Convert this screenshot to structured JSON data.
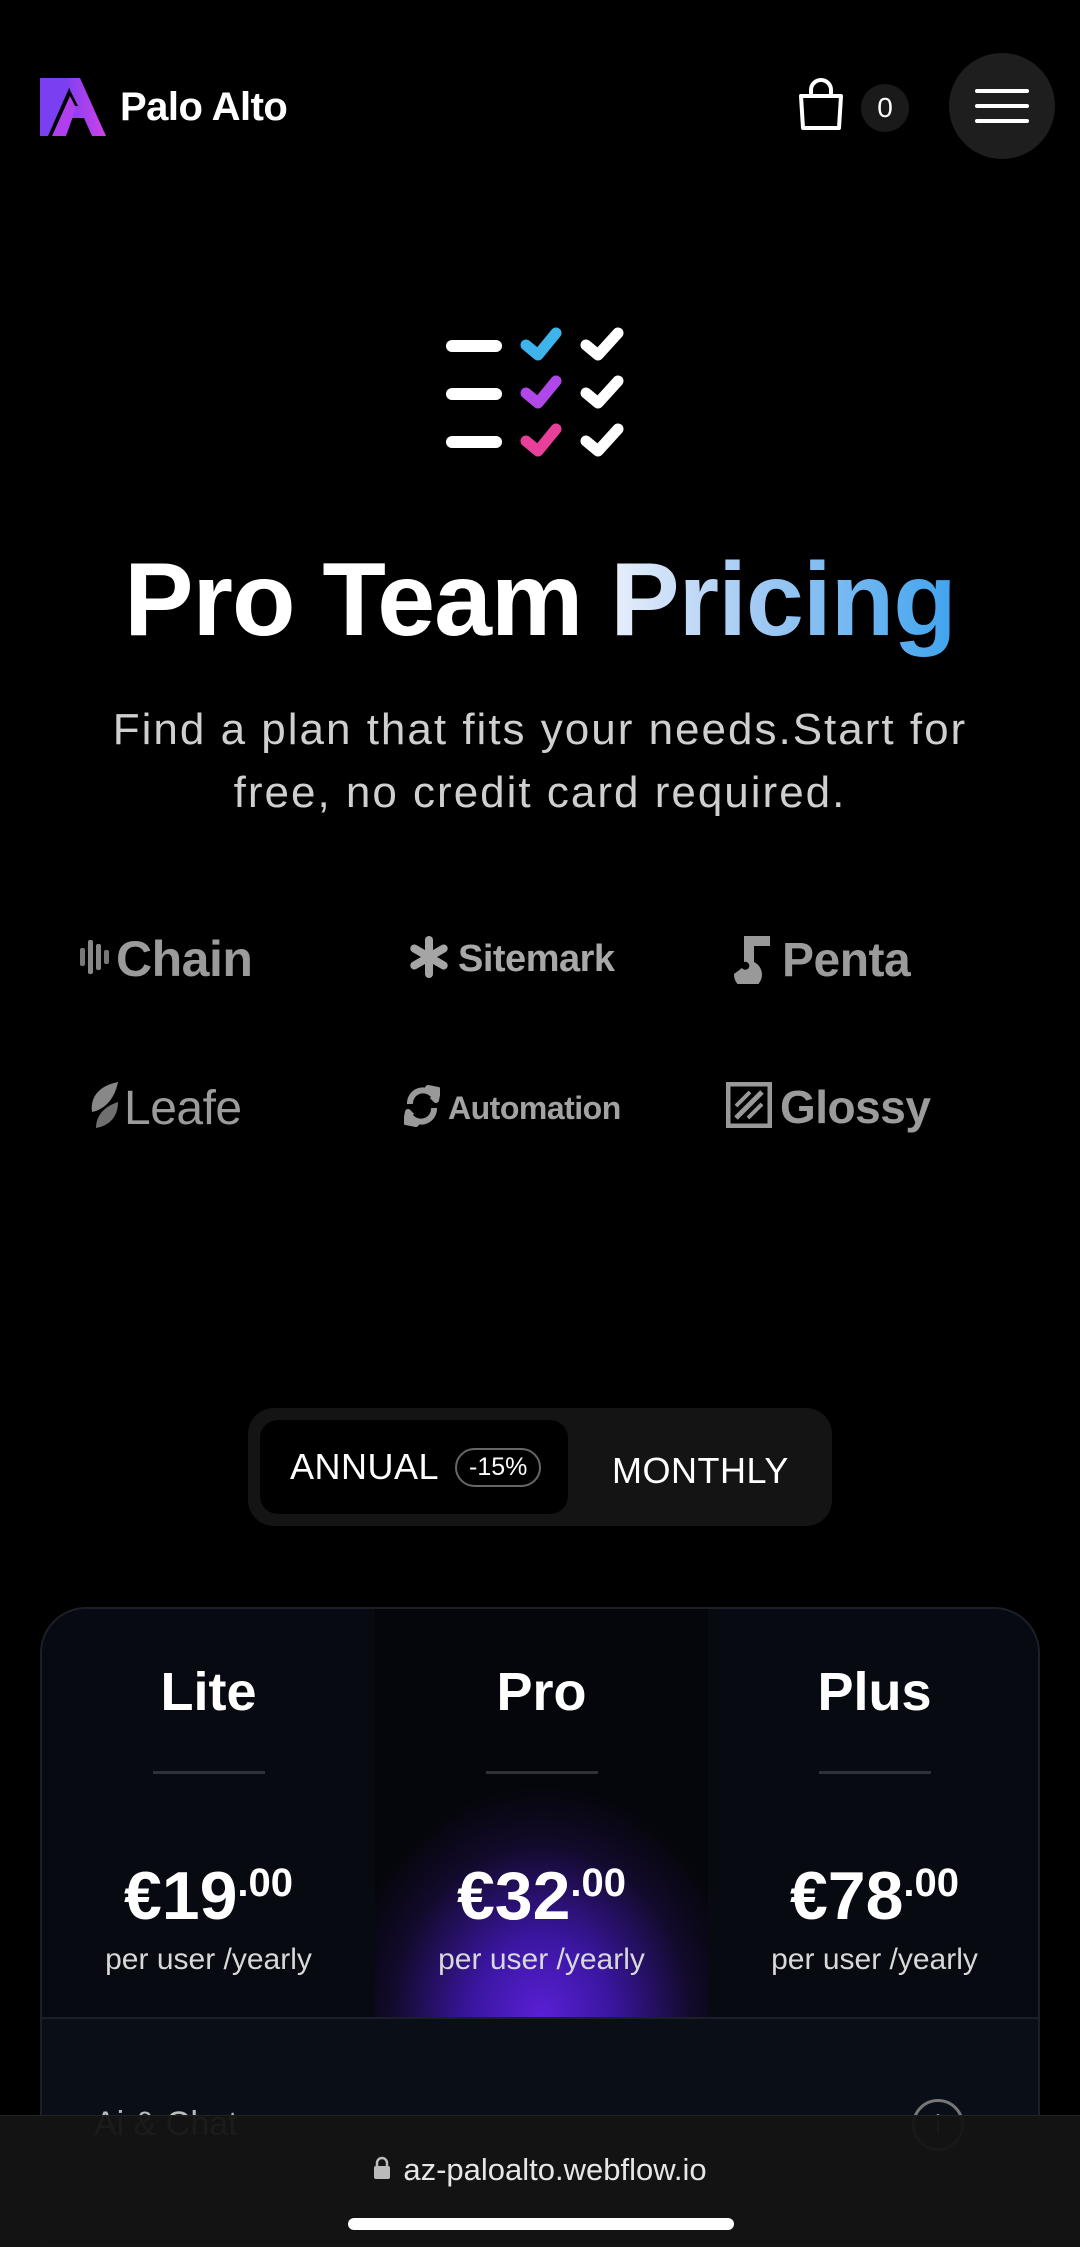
{
  "header": {
    "logo_text": "Palo Alto",
    "cart_count": "0",
    "icons": {
      "cart": "shopping-bag-icon",
      "menu": "hamburger-menu-icon"
    },
    "brand_colors": [
      "#7b3ff2",
      "#b03ff0",
      "#d042e8"
    ]
  },
  "hero": {
    "icon": "checklist-icon",
    "title_part1": "Pro Team ",
    "title_part2": "Pricing",
    "subtitle": "Find a plan that fits your needs.Start for free, no credit card required."
  },
  "brands": [
    {
      "name": "Chain",
      "icon": "chain-bars-icon"
    },
    {
      "name": "Sitemark",
      "icon": "asterisk-icon"
    },
    {
      "name": "Penta",
      "icon": "penta-icon"
    },
    {
      "name": "Leafe",
      "icon": "leaf-icon"
    },
    {
      "name": "Automation",
      "icon": "sync-icon"
    },
    {
      "name": "Glossy",
      "icon": "glossy-icon"
    }
  ],
  "billing_toggle": {
    "annual_label": "ANNUAL",
    "discount": "-15%",
    "monthly_label": "MONTHLY",
    "selected": "ANNUAL"
  },
  "plans": [
    {
      "name": "Lite",
      "currency": "€",
      "price": "19",
      "cents": ".00",
      "period": "per user /yearly"
    },
    {
      "name": "Pro",
      "currency": "€",
      "price": "32",
      "cents": ".00",
      "period": "per user /yearly"
    },
    {
      "name": "Plus",
      "currency": "€",
      "price": "78",
      "cents": ".00",
      "period": "per user /yearly"
    }
  ],
  "feature_row": {
    "label": "Ai & Chat",
    "icon": "info-icon"
  },
  "browser": {
    "url": "az-paloalto.webflow.io",
    "icon": "lock-icon"
  }
}
